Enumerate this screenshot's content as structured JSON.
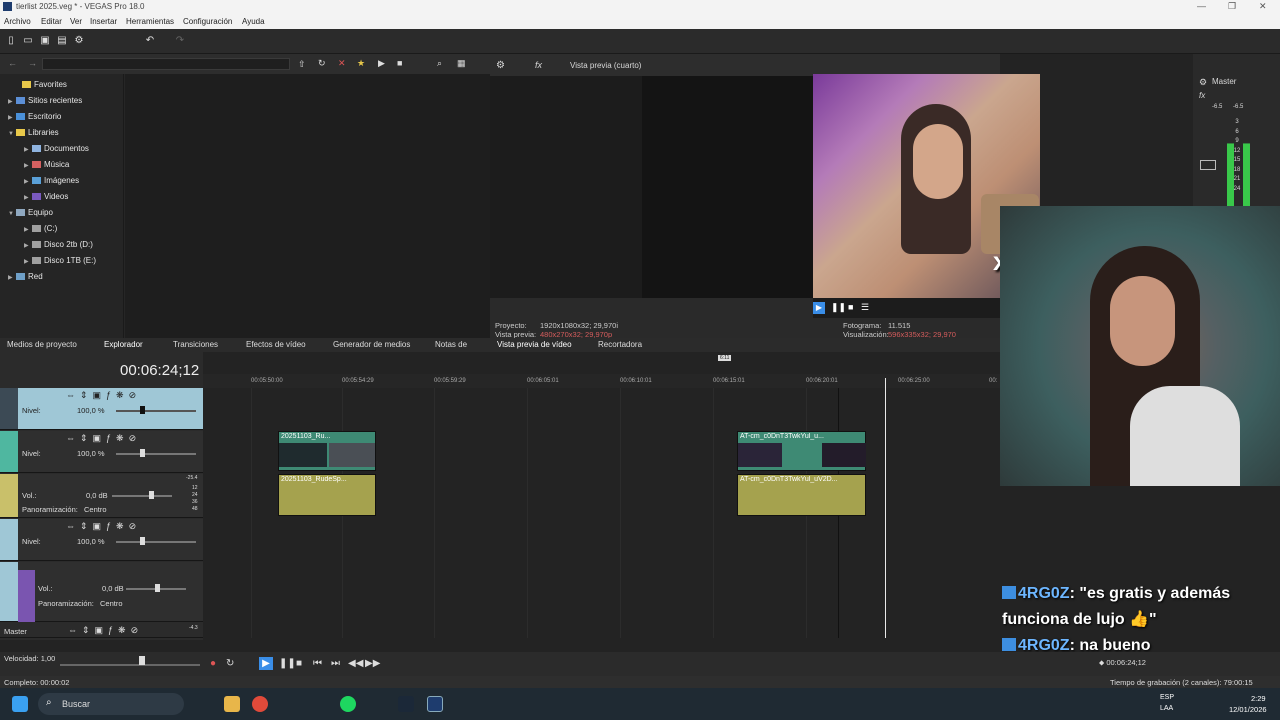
{
  "window": {
    "title": "tierlist 2025.veg * - VEGAS Pro 18.0",
    "controls": [
      "—",
      "❐",
      "✕"
    ]
  },
  "menu": {
    "items": [
      "Archivo",
      "Editar",
      "Ver",
      "Insertar",
      "Herramientas",
      "Configuración",
      "Ayuda"
    ]
  },
  "explorer": {
    "tree": [
      {
        "label": "Favorites",
        "indent": 1,
        "arrow": ""
      },
      {
        "label": "Sitios recientes",
        "indent": 0,
        "arrow": "▶"
      },
      {
        "label": "Escritorio",
        "indent": 0,
        "arrow": "▶"
      },
      {
        "label": "Libraries",
        "indent": 0,
        "arrow": "▼"
      },
      {
        "label": "Documentos",
        "indent": 1,
        "arrow": "▶"
      },
      {
        "label": "Música",
        "indent": 1,
        "arrow": "▶"
      },
      {
        "label": "Imágenes",
        "indent": 1,
        "arrow": "▶"
      },
      {
        "label": "Videos",
        "indent": 1,
        "arrow": "▶"
      },
      {
        "label": "Equipo",
        "indent": 0,
        "arrow": "▼"
      },
      {
        "label": "(C:)",
        "indent": 1,
        "arrow": "▶"
      },
      {
        "label": "Disco 2tb (D:)",
        "indent": 1,
        "arrow": "▶"
      },
      {
        "label": "Disco 1TB (E:)",
        "indent": 1,
        "arrow": "▶"
      },
      {
        "label": "Red",
        "indent": 0,
        "arrow": "▶"
      }
    ],
    "tabs": [
      "Medios de proyecto",
      "Explorador",
      "Transiciones",
      "Efectos de vídeo",
      "Generador de medios",
      "Notas de"
    ]
  },
  "preview": {
    "mode": "Vista previa (cuarto)",
    "info": {
      "proyecto_label": "Proyecto:",
      "proyecto_value": "1920x1080x32; 29,970i",
      "vista_label": "Vista previa:",
      "vista_value": "480x270x32; 29,970p",
      "fotograma_label": "Fotograma:",
      "fotograma_value": "11.515",
      "visualizacion_label": "Visualización:",
      "visualizacion_value": "596x335x32; 29,970"
    },
    "tabs": [
      "Vista previa de vídeo",
      "Recortadora"
    ],
    "overlay_text": "x2"
  },
  "mixer": {
    "title": "Master",
    "left_db": "-6.5",
    "right_db": "-6.5",
    "scale": [
      "3",
      "6",
      "9",
      "12",
      "15",
      "18",
      "21",
      "24"
    ]
  },
  "timeline": {
    "timecode": "00:06:24;12",
    "ruler": [
      "00:05:50:00",
      "00:05:54:29",
      "00:05:59:29",
      "00:06:05:01",
      "00:06:10:01",
      "00:06:15:01",
      "00:06:20:01",
      "00:06:25:00",
      "00:"
    ],
    "region_marker": "6:11",
    "tracks": {
      "t1_level_label": "Nivel:",
      "t1_level_value": "100,0 %",
      "t2_level_label": "Nivel:",
      "t2_level_value": "100,0 %",
      "t3_vol_label": "Vol.:",
      "t3_vol_value": "0,0 dB",
      "t3_pan_label": "Panoramización:",
      "t3_pan_value": "Centro",
      "t3_scale": [
        "-25.4",
        "12",
        "24",
        "36",
        "48"
      ],
      "t4_level_label": "Nivel:",
      "t4_level_value": "100,0 %",
      "t5_vol_label": "Vol.:",
      "t5_vol_value": "0,0 dB",
      "t5_pan_label": "Panoramización:",
      "t5_pan_value": "Centro",
      "master_label": "Master",
      "master_value": "-4.3"
    },
    "clips": {
      "v1": "20251103_Ru...",
      "a1": "20251103_RudeSp...",
      "v2": "AT-cm_c0DnT3TwkYul_u...",
      "a2": "AT-cm_c0DnT3TwkYul_uV2D..."
    }
  },
  "transport": {
    "speed_label": "Velocidad: 1,00",
    "position": "00:06:24;12"
  },
  "status": {
    "left": "Completo: 00:00:02",
    "right": "Tiempo de grabación (2 canales): 79:00:15"
  },
  "chat": [
    {
      "user": "4RG0Z",
      "text": ": \"es gratis y además"
    },
    {
      "user": "",
      "text": "funciona de lujo 👍\""
    },
    {
      "user": "4RG0Z",
      "text": ": na bueno"
    }
  ],
  "taskbar": {
    "search_placeholder": "Buscar",
    "lang_top": "ESP",
    "lang_bottom": "LAA",
    "time": "2:29",
    "date": "12/01/2026"
  },
  "colors": {
    "video_track": "#9fc7d6",
    "video_track2": "#4fb7a0",
    "audio_track": "#c9c06a",
    "audio_track2": "#7a55b0",
    "video_clip": "#3e8a74",
    "audio_clip": "#a5a24e",
    "chat_name": "#6db6ff"
  }
}
